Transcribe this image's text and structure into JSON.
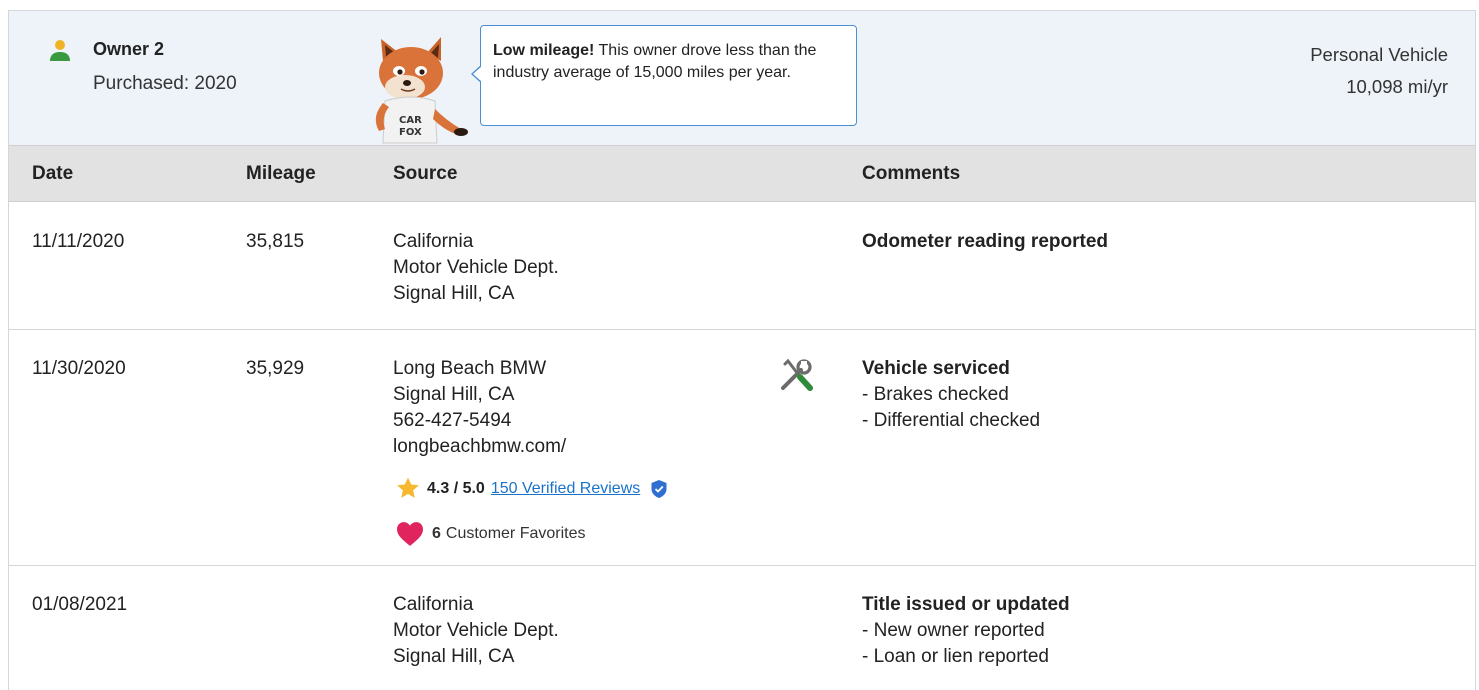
{
  "owner": {
    "name": "Owner 2",
    "purchased": "Purchased: 2020",
    "vehicle_type": "Personal Vehicle",
    "miles_per_year": "10,098 mi/yr"
  },
  "tip": {
    "bold": "Low mileage!",
    "text": " This owner drove less than the industry average of 15,000 miles per year."
  },
  "table": {
    "headers": {
      "date": "Date",
      "mileage": "Mileage",
      "source": "Source",
      "comments": "Comments"
    },
    "rows": [
      {
        "date": "11/11/2020",
        "mileage": "35,815",
        "source": [
          "California",
          "Motor Vehicle Dept.",
          "Signal Hill, CA"
        ],
        "comment_title": "Odometer reading reported",
        "comment_items": []
      },
      {
        "date": "11/30/2020",
        "mileage": "35,929",
        "source": [
          "Long Beach BMW",
          "Signal Hill, CA",
          "562-427-5494",
          "longbeachbmw.com/"
        ],
        "rating": {
          "score": "4.3 / 5.0",
          "reviews_link": "150 Verified Reviews"
        },
        "favorites": {
          "count": "6",
          "label": "Customer Favorites"
        },
        "comment_title": "Vehicle serviced",
        "comment_items": [
          "- Brakes checked",
          "- Differential checked"
        ]
      },
      {
        "date": "01/08/2021",
        "mileage": "",
        "source": [
          "California",
          "Motor Vehicle Dept.",
          "Signal Hill, CA"
        ],
        "comment_title": "Title issued or updated",
        "comment_items": [
          "- New owner reported",
          "- Loan or lien reported"
        ]
      }
    ]
  },
  "colors": {
    "header_bg": "#edf3f9",
    "table_head_bg": "#e2e2e2",
    "owner_icon": "#f0b323",
    "owner_icon_body": "#3a9a3f",
    "link": "#1a73c9",
    "star": "#f5b82e",
    "heart": "#e0245e",
    "verified": "#2f6fd1",
    "service_green": "#2e8b3a"
  },
  "icons": {
    "owner": "person-icon",
    "fox": "carfox-mascot",
    "service": "wrench-screwdriver-icon",
    "star": "star-icon",
    "verified": "verified-shield-icon",
    "heart": "heart-icon"
  }
}
